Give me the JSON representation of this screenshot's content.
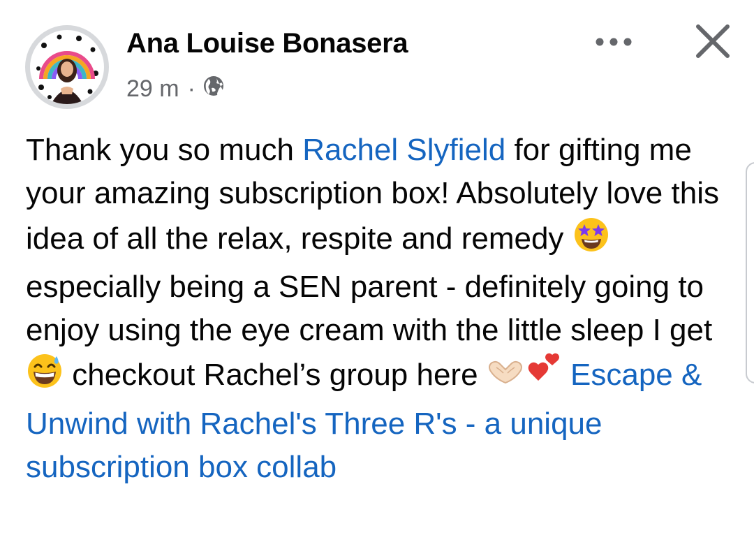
{
  "post": {
    "author": "Ana Louise Bonasera",
    "time": "29 m",
    "separator": "·",
    "audience_icon": "globe-icon",
    "body": {
      "part1": "Thank you so much ",
      "mention": "Rachel Slyfield",
      "part2": " for gifting me your amazing subscription box! Absolutely love this idea of all the relax, respite and remedy ",
      "emoji1": "star-struck-emoji",
      "part3": " especially being a SEN parent - definitely going to enjoy using the eye cream with the little sleep I get ",
      "emoji2": "grinning-sweat-emoji",
      "part4": " checkout Rachel’s group here ",
      "emoji3": "heart-hands-emoji",
      "emoji4": "two-hearts-emoji",
      "group_link": "Escape & Unwind with Rachel's Three R's - a unique subscription box collab"
    }
  },
  "header": {
    "more_icon": "more-horizontal-icon",
    "close_icon": "close-icon"
  },
  "colors": {
    "text": "#050505",
    "secondary": "#65676b",
    "link": "#1565c0",
    "ring": "#d7d9dc"
  }
}
